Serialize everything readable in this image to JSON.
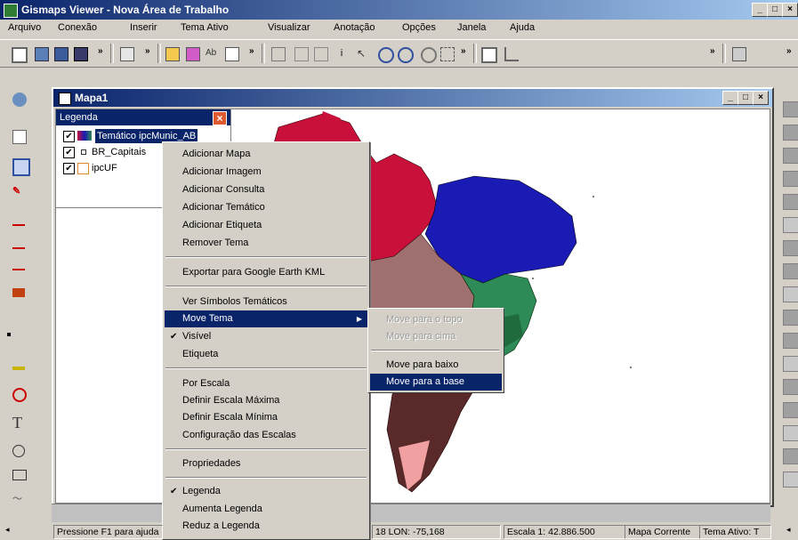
{
  "window": {
    "title": "Gismaps Viewer - Nova Área de Trabalho",
    "controls": [
      "_",
      "□",
      "×"
    ]
  },
  "menubar": [
    "Arquivo",
    "Conexão",
    "Inserir",
    "Tema Ativo",
    "Visualizar",
    "Anotação",
    "Opções",
    "Janela",
    "Ajuda"
  ],
  "child_window": {
    "title": "Mapa1",
    "controls": [
      "_",
      "□",
      "×"
    ]
  },
  "legend": {
    "title": "Legenda",
    "close_glyph": "×",
    "items": [
      {
        "label": "Temático ipcMunic_AB",
        "checked": true
      },
      {
        "label": "BR_Capitais",
        "checked": true
      },
      {
        "label": "ipcUF",
        "checked": true
      }
    ]
  },
  "context_menu": {
    "items": [
      "Adicionar Mapa",
      "Adicionar Imagem",
      "Adicionar Consulta",
      "Adicionar Temático",
      "Adicionar Etiqueta",
      "Remover Tema",
      "Exportar para Google Earth KML",
      "Ver Símbolos Temáticos",
      "Move Tema",
      "Visível",
      "Etiqueta",
      "Por Escala",
      "Definir Escala Máxima",
      "Definir Escala Mínima",
      "Configuração das Escalas",
      "Propriedades",
      "Legenda",
      "Aumenta Legenda",
      "Reduz a Legenda"
    ],
    "highlighted": "Move Tema",
    "check_glyph": "✔",
    "submenu_arrow": "▶"
  },
  "submenu": {
    "items": [
      {
        "label": "Move para o topo",
        "enabled": false
      },
      {
        "label": "Move para cima",
        "enabled": false
      },
      {
        "label": "Move para baixo",
        "enabled": true
      },
      {
        "label": "Move para a base",
        "enabled": true
      }
    ],
    "highlighted": "Move para a base"
  },
  "statusbar": {
    "hint": "Pressione F1 para ajuda",
    "coords": "18 LON: -75,168",
    "scale": "Escala 1: 42.886.500",
    "map": "Mapa Corrente",
    "theme": "Tema Ativo: T"
  },
  "colors": {
    "titlebar": "#0a246a",
    "highlight": "#0a246a",
    "region_north": "#c8103a",
    "region_northeast": "#1a1ab4",
    "region_center": "#a07070",
    "region_southeast": "#2e8b57",
    "region_south": "#f0a0a0"
  }
}
